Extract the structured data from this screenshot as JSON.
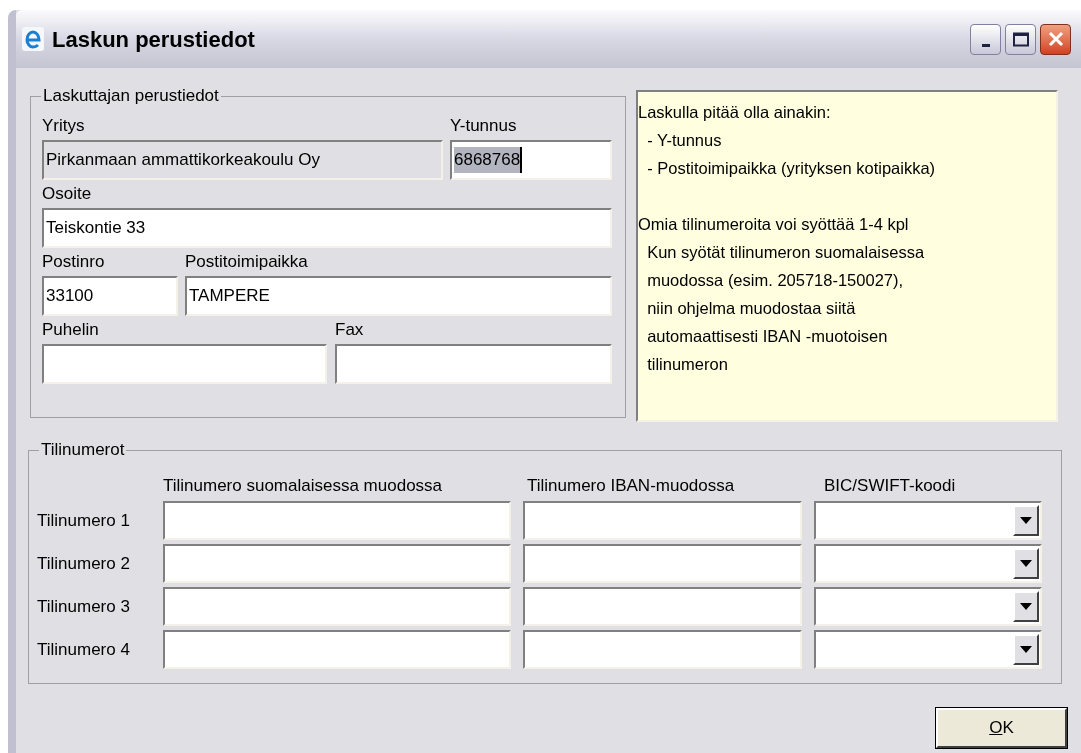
{
  "window": {
    "title": "Laskun perustiedot"
  },
  "company": {
    "legend": "Laskuttajan perustiedot",
    "fields": [
      {
        "label": "Yritys",
        "value": "Pirkanmaan ammattikorkeakoulu Oy",
        "disabled": true
      },
      {
        "label": "Y-tunnus",
        "value": "6868768",
        "disabled": false,
        "value_selected": true
      },
      {
        "label": "Osoite",
        "value": "Teiskontie 33",
        "disabled": false
      },
      {
        "label": "Postinro",
        "value": "33100",
        "disabled": false
      },
      {
        "label": "Postitoimipaikka",
        "value": "TAMPERE",
        "disabled": false
      },
      {
        "label": "Puhelin",
        "disabled": false
      },
      {
        "label": "Fax",
        "disabled": false
      }
    ]
  },
  "info": {
    "paragraphs": [
      [
        "Laskulla pitää olla ainakin:",
        "  - Y-tunnus",
        "  - Postitoimipaikka (yrityksen kotipaikka)"
      ],
      [
        "Omia tilinumeroita voi syöttää 1-4 kpl",
        "  Kun syötät tilinumeron suomalaisessa",
        "  muodossa (esim. 205718-150027),",
        "  niin ohjelma muodostaa siitä",
        "  automaattisesti IBAN -muotoisen",
        "  tilinumeron"
      ]
    ]
  },
  "accounts": {
    "legend": "Tilinumerot",
    "columns": [
      "Tilinumero suomalaisessa muodossa",
      "Tilinumero IBAN-muodossa",
      "BIC/SWIFT-koodi"
    ],
    "rows": [
      {
        "label": "Tilinumero 1"
      },
      {
        "label": "Tilinumero 2"
      },
      {
        "label": "Tilinumero 3"
      },
      {
        "label": "Tilinumero 4"
      }
    ]
  },
  "ok_button": {
    "mnemonic": "O",
    "label_rest": "K"
  }
}
